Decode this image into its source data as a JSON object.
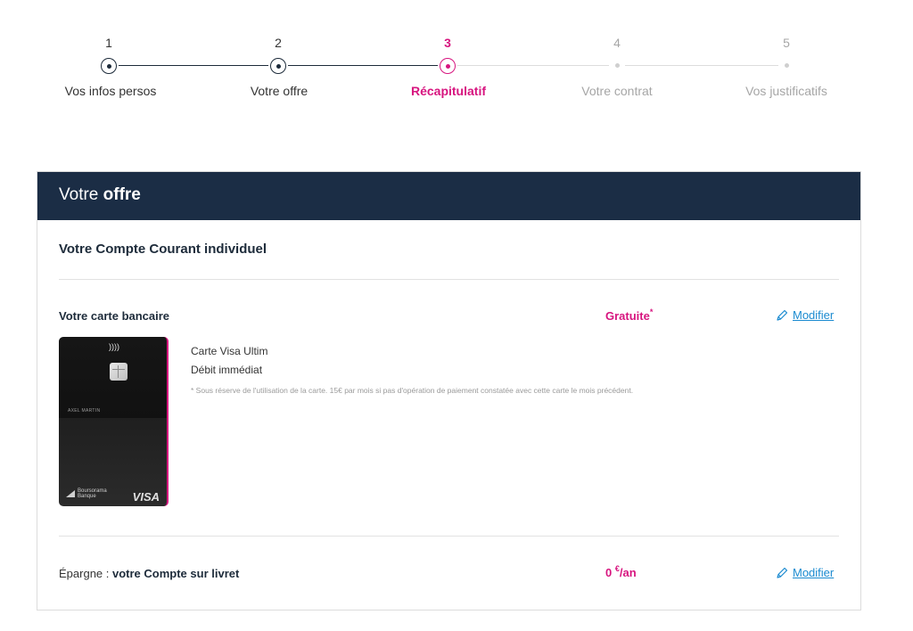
{
  "stepper": {
    "steps": [
      {
        "number": "1",
        "label": "Vos infos persos",
        "state": "done"
      },
      {
        "number": "2",
        "label": "Votre offre",
        "state": "done"
      },
      {
        "number": "3",
        "label": "Récapitulatif",
        "state": "active"
      },
      {
        "number": "4",
        "label": "Votre contrat",
        "state": "upcoming"
      },
      {
        "number": "5",
        "label": "Vos justificatifs",
        "state": "upcoming"
      }
    ]
  },
  "panel": {
    "header_prefix": "Votre",
    "header_bold": "offre",
    "section_title": "Votre Compte Courant individuel",
    "card_row": {
      "title": "Votre carte bancaire",
      "price": "Gratuite",
      "price_mark": "*",
      "modify_label": "Modifier",
      "card_name": "Carte Visa Ultim",
      "debit_type": "Débit immédiat",
      "note": "* Sous réserve de l'utilisation de la carte. 15€ par mois si pas d'opération de paiement constatée avec cette carte le mois précédent.",
      "card_holder": "AXEL MARTIN",
      "card_brand": "VISA",
      "bank_logo_line1": "Boursorama",
      "bank_logo_line2": "Banque",
      "nfc_symbol": "))))"
    },
    "savings_row": {
      "label_prefix": "Épargne :",
      "label_bold": "votre Compte sur livret",
      "price_value": "0",
      "price_currency": "€",
      "price_period": "/an",
      "modify_label": "Modifier"
    }
  },
  "colors": {
    "accent": "#d7157f",
    "header_bg": "#1b2d45",
    "link": "#1a8ad0"
  }
}
